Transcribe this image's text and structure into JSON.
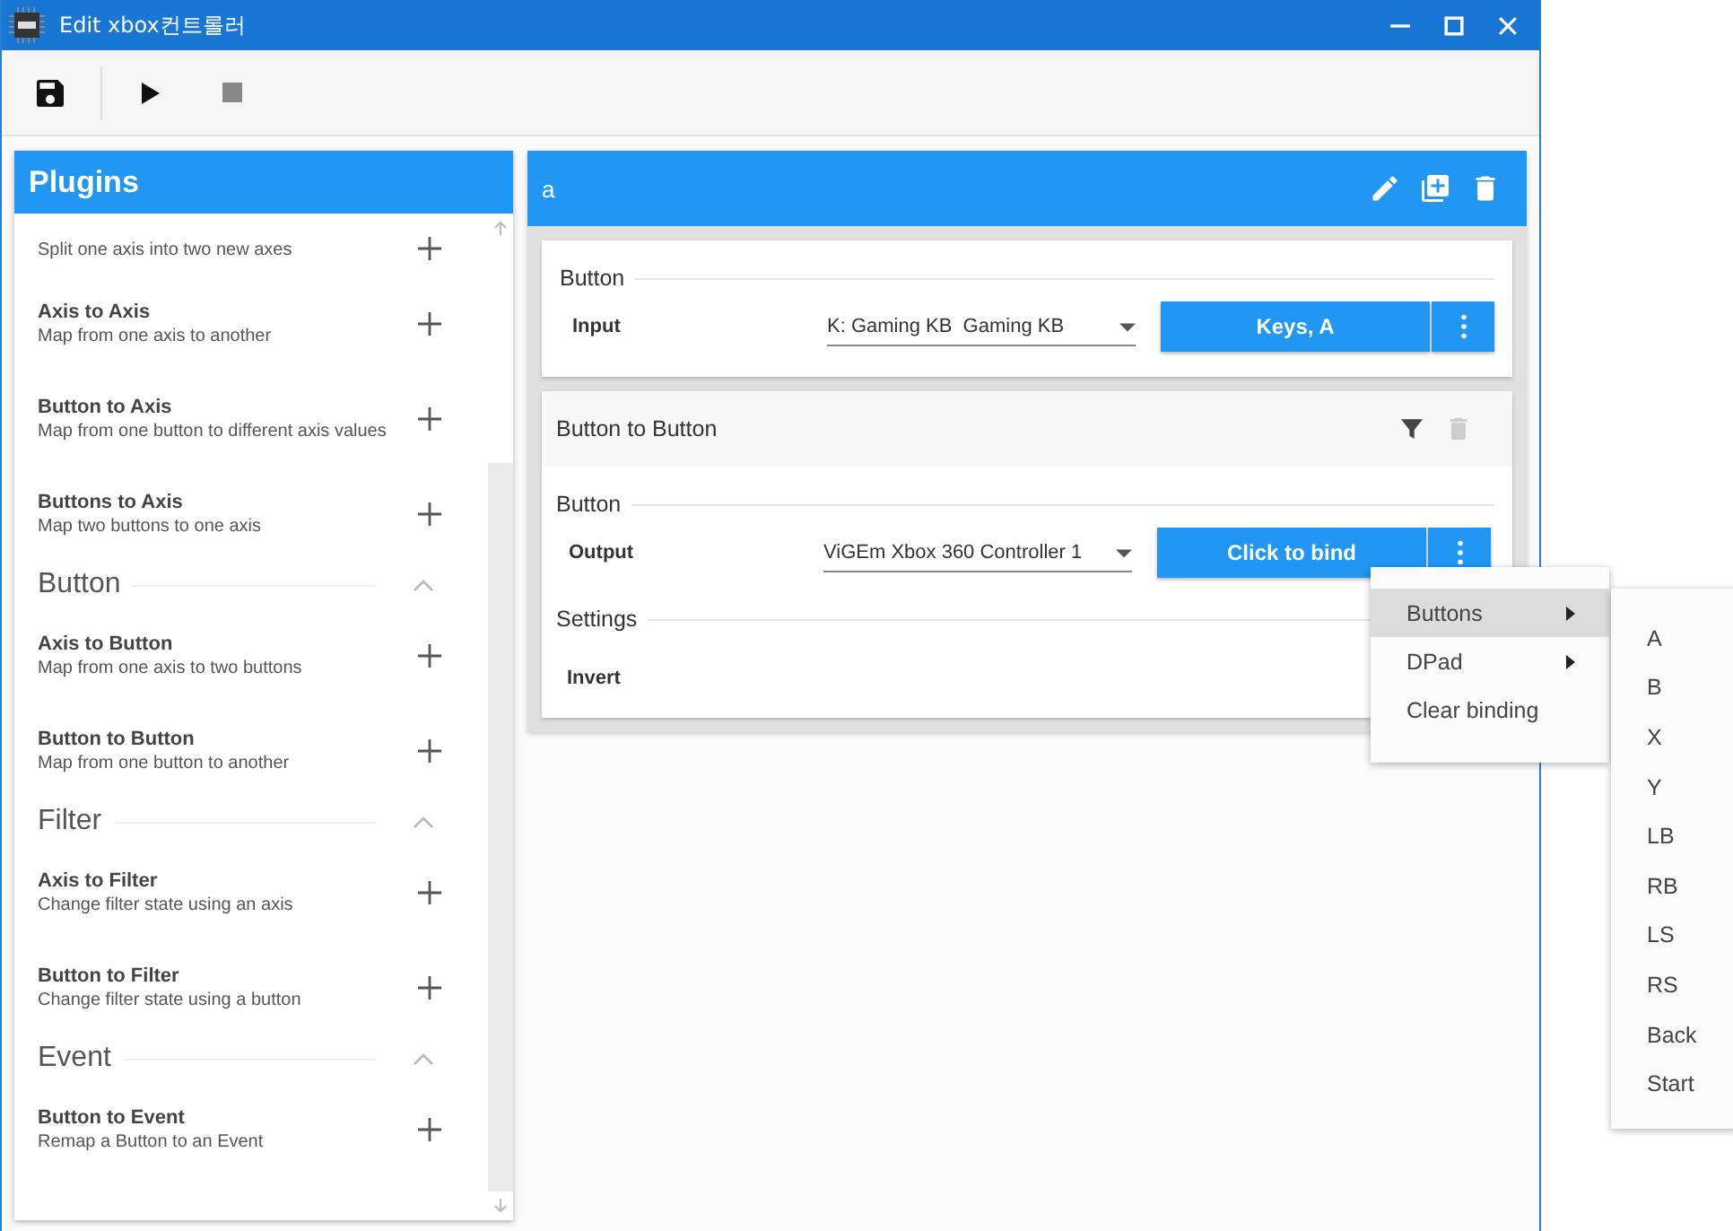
{
  "window": {
    "title": "Edit xbox컨트롤러"
  },
  "plugins": {
    "title": "Plugins",
    "groups": [
      {
        "items": [
          {
            "description": "Split one axis into two new axes"
          },
          {
            "name": "Axis to Axis",
            "description": "Map from one axis to another"
          },
          {
            "name": "Button to Axis",
            "description": "Map from one button to different axis values"
          },
          {
            "name": "Buttons to Axis",
            "description": "Map two buttons to one axis"
          }
        ]
      },
      {
        "heading": "Button",
        "expanded": true,
        "items": [
          {
            "name": "Axis to Button",
            "description": "Map from one axis to two buttons"
          },
          {
            "name": "Button to Button",
            "description": "Map from one button to another"
          }
        ]
      },
      {
        "heading": "Filter",
        "expanded": true,
        "items": [
          {
            "name": "Axis to Filter",
            "description": "Change filter state using an axis"
          },
          {
            "name": "Button to Filter",
            "description": "Change filter state using a button"
          }
        ]
      },
      {
        "heading": "Event",
        "expanded": true,
        "items": [
          {
            "name": "Button to Event",
            "description": "Remap a Button to an Event"
          }
        ]
      }
    ]
  },
  "profile": {
    "title": "a",
    "input_card": {
      "section": "Button",
      "label": "Input",
      "device": "K: Gaming KB  Gaming KB",
      "binding": "Keys, A"
    },
    "plugin_card": {
      "title": "Button to Button",
      "delete_disabled": true,
      "section": "Button",
      "label": "Output",
      "device": "ViGEm Xbox 360 Controller 1",
      "binding": "Click to bind",
      "settings_heading": "Settings",
      "settings": [
        {
          "label": "Invert"
        }
      ]
    }
  },
  "context_menu": {
    "items": [
      {
        "label": "Buttons",
        "has_submenu": true,
        "selected": true
      },
      {
        "label": "DPad",
        "has_submenu": true,
        "selected": false
      },
      {
        "label": "Clear binding",
        "has_submenu": false,
        "selected": false
      }
    ],
    "submenu": [
      "A",
      "B",
      "X",
      "Y",
      "LB",
      "RB",
      "LS",
      "RS",
      "Back",
      "Start"
    ]
  }
}
